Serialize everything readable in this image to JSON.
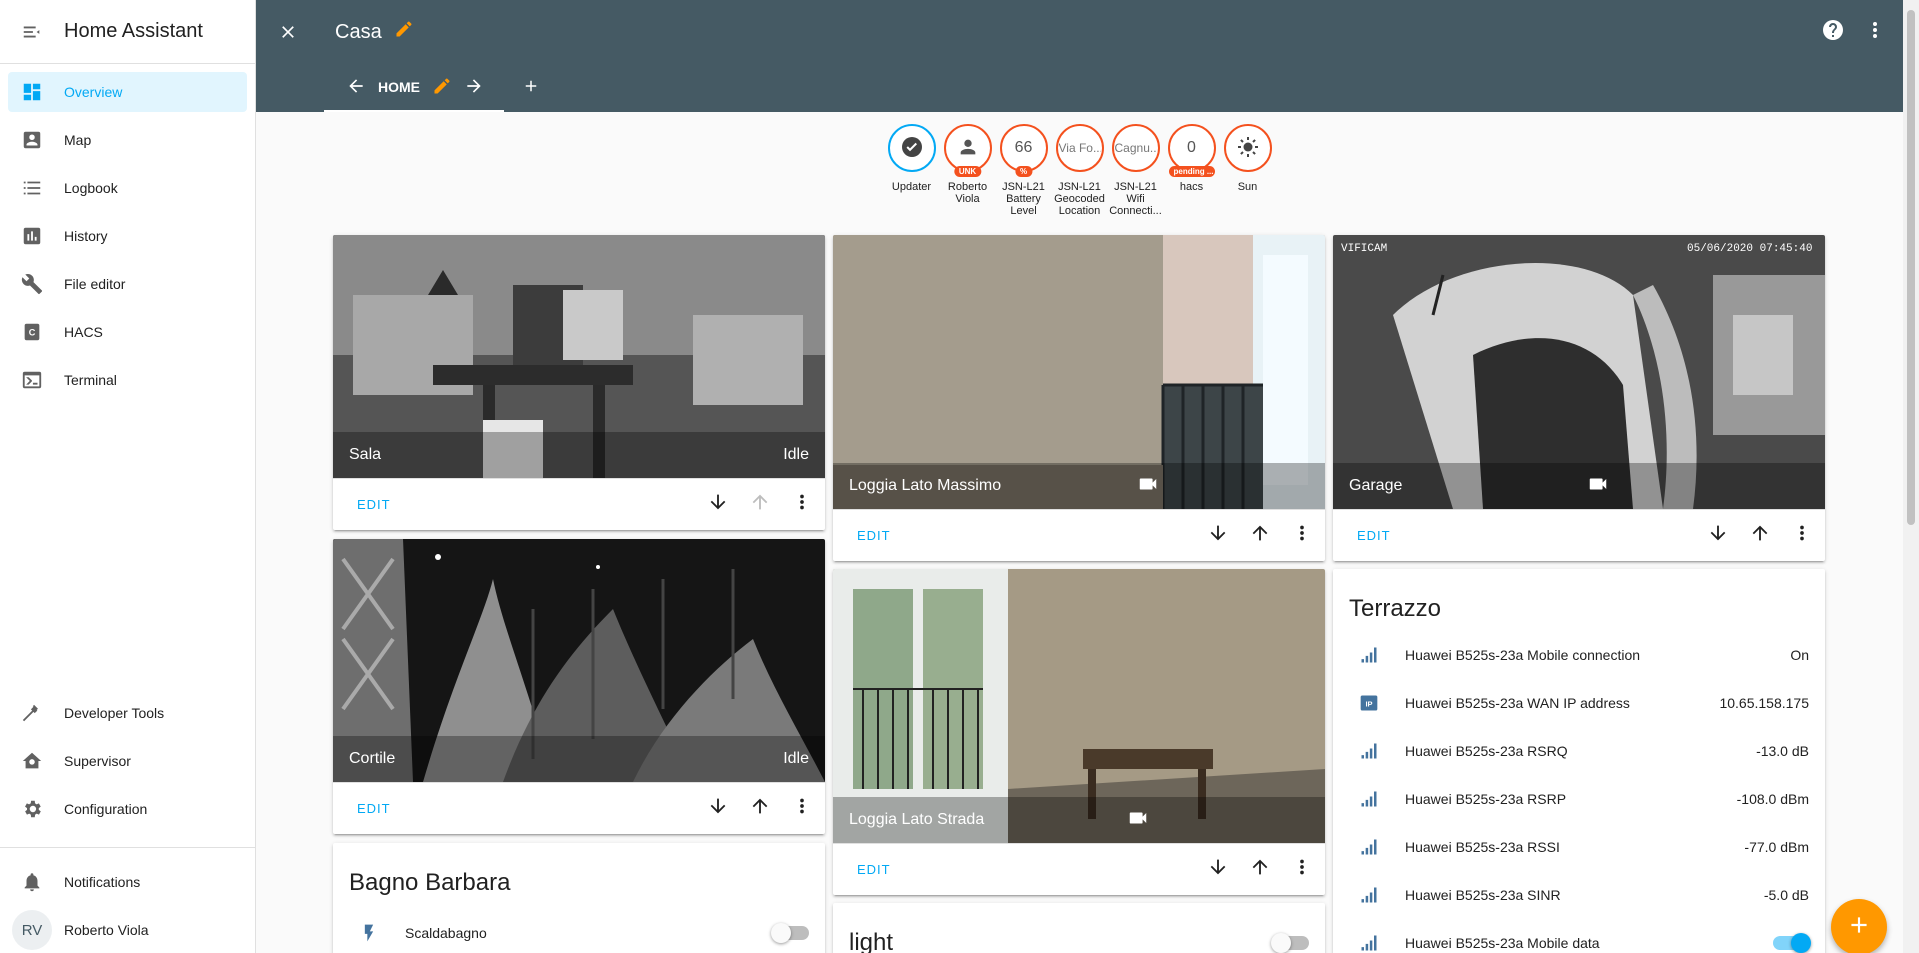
{
  "app": {
    "title": "Home Assistant"
  },
  "sidebar": {
    "items": [
      {
        "label": "Overview",
        "icon": "dashboard-icon"
      },
      {
        "label": "Map",
        "icon": "map-person-icon"
      },
      {
        "label": "Logbook",
        "icon": "list-icon"
      },
      {
        "label": "History",
        "icon": "chart-icon"
      },
      {
        "label": "File editor",
        "icon": "wrench-icon"
      },
      {
        "label": "HACS",
        "icon": "hacs-icon"
      },
      {
        "label": "Terminal",
        "icon": "console-icon"
      }
    ],
    "bottom_items": [
      {
        "label": "Developer Tools",
        "icon": "hammer-icon"
      },
      {
        "label": "Supervisor",
        "icon": "home-gear-icon"
      },
      {
        "label": "Configuration",
        "icon": "gear-icon"
      }
    ],
    "notifications": "Notifications",
    "user": {
      "name": "Roberto Viola",
      "initials": "RV"
    }
  },
  "header": {
    "title": "Casa",
    "tab": "HOME"
  },
  "badges": [
    {
      "value": "",
      "label": "Updater",
      "style": "check"
    },
    {
      "value": "",
      "pill": "UNK",
      "label": "Roberto Viola",
      "style": "person"
    },
    {
      "value": "66",
      "pill": "%",
      "label": "JSN-L21 Battery Level"
    },
    {
      "value": "Via Fo...",
      "label": "JSN-L21 Geocoded Location"
    },
    {
      "value": "Cagnu...",
      "label": "JSN-L21 Wifi Connecti..."
    },
    {
      "value": "0",
      "pill": "pending ...",
      "label": "hacs"
    },
    {
      "value": "",
      "label": "Sun",
      "style": "sun"
    }
  ],
  "cards": {
    "sala": {
      "name": "Sala",
      "state": "Idle",
      "edit": "EDIT"
    },
    "cortile": {
      "name": "Cortile",
      "state": "Idle",
      "edit": "EDIT"
    },
    "loggia_massimo": {
      "name": "Loggia Lato Massimo",
      "edit": "EDIT"
    },
    "loggia_strada": {
      "name": "Loggia Lato Strada",
      "edit": "EDIT"
    },
    "garage": {
      "name": "Garage",
      "edit": "EDIT",
      "osd_left": "VIFICAM",
      "osd_right": "05/06/2020 07:45:40"
    },
    "bagno": {
      "title": "Bagno Barbara",
      "entity": "Scaldabagno"
    },
    "light": {
      "title": "light"
    },
    "terrazzo": {
      "title": "Terrazzo",
      "rows": [
        {
          "name": "Huawei B525s-23a Mobile connection",
          "state": "On",
          "icon": "signal-full-icon"
        },
        {
          "name": "Huawei B525s-23a WAN IP address",
          "state": "10.65.158.175",
          "icon": "ip-icon"
        },
        {
          "name": "Huawei B525s-23a RSRQ",
          "state": "-13.0 dB",
          "icon": "signal-icon"
        },
        {
          "name": "Huawei B525s-23a RSRP",
          "state": "-108.0 dBm",
          "icon": "signal-icon"
        },
        {
          "name": "Huawei B525s-23a RSSI",
          "state": "-77.0 dBm",
          "icon": "signal-icon"
        },
        {
          "name": "Huawei B525s-23a SINR",
          "state": "-5.0 dB",
          "icon": "signal-icon"
        },
        {
          "name": "Huawei B525s-23a Mobile data",
          "state": "",
          "icon": "signal-full-icon",
          "toggle": true
        }
      ]
    }
  },
  "colors": {
    "header": "#455a64",
    "accent": "#03a9f4",
    "badge_border": "#f4511e",
    "fab": "#ff9800"
  }
}
